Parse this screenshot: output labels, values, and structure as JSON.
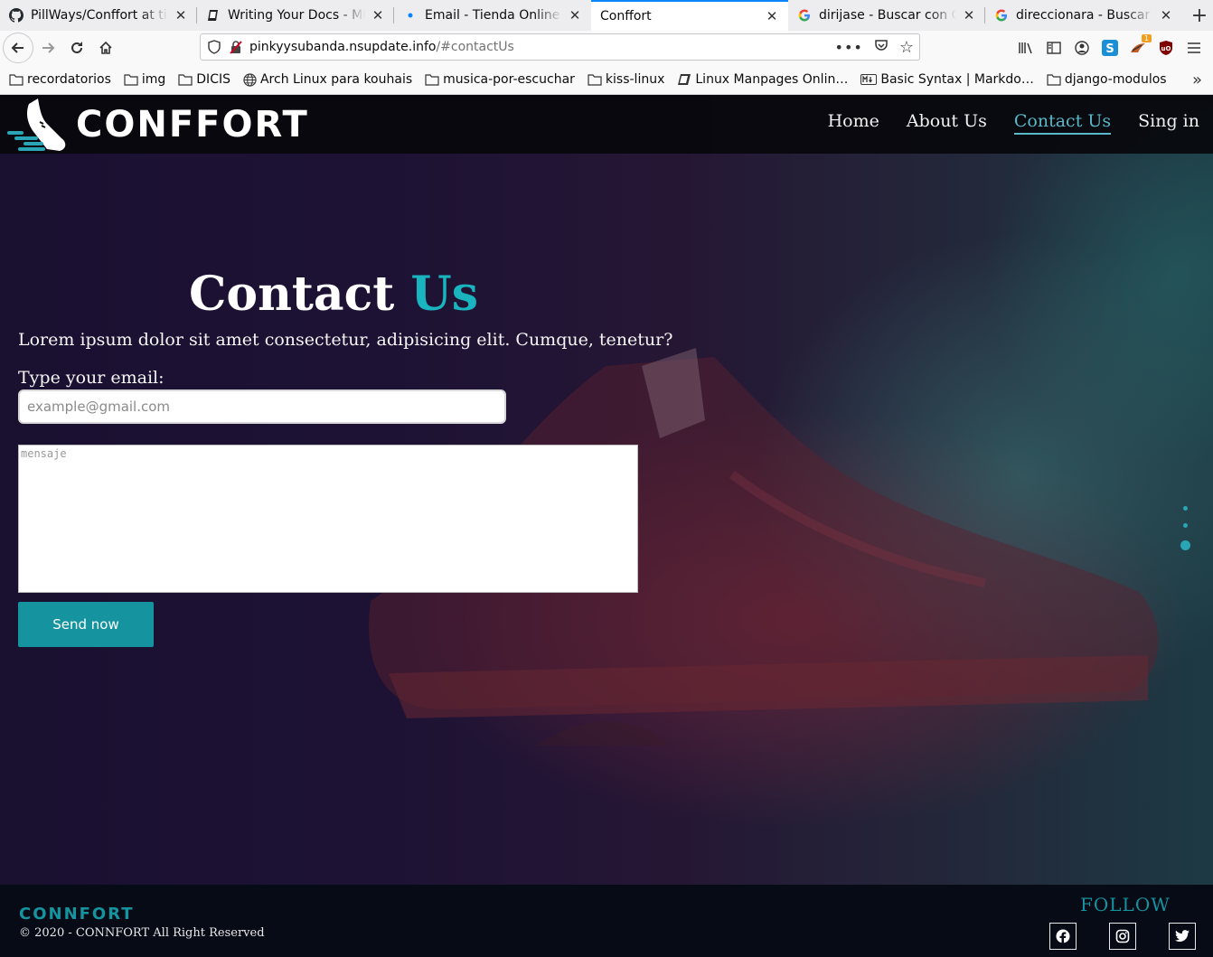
{
  "browser": {
    "tabs": [
      {
        "title": "PillWays/Conffort at tier",
        "icon": "github-icon"
      },
      {
        "title": "Writing Your Docs - MkDocs",
        "icon": "book-icon"
      },
      {
        "title": "Email - Tienda Online Conffort",
        "icon": "dot-icon"
      },
      {
        "title": "Conffort",
        "icon": "none",
        "active": true
      },
      {
        "title": "dirijase - Buscar con Google",
        "icon": "google-icon"
      },
      {
        "title": "direccionara - Buscar con Google",
        "icon": "google-icon"
      }
    ],
    "url_host": "pinkyysubanda.nsupdate.info",
    "url_path": "/#contactUs",
    "bookmarks": [
      {
        "label": "recordatorios",
        "icon": "folder-icon"
      },
      {
        "label": "img",
        "icon": "folder-icon"
      },
      {
        "label": "DICIS",
        "icon": "folder-icon"
      },
      {
        "label": "Arch Linux para kouhais",
        "icon": "globe-icon"
      },
      {
        "label": "musica-por-escuchar",
        "icon": "folder-icon"
      },
      {
        "label": "kiss-linux",
        "icon": "folder-icon"
      },
      {
        "label": "Linux Manpages Onlin…",
        "icon": "book-icon"
      },
      {
        "label": "Basic Syntax | Markdo…",
        "icon": "markdown-icon"
      },
      {
        "label": "django-modulos",
        "icon": "folder-icon"
      }
    ],
    "addon_badge": "1"
  },
  "site": {
    "logo_text": "CONFFORT",
    "nav": [
      "Home",
      "About Us",
      "Contact Us",
      "Sing in"
    ],
    "active_nav": "Contact Us",
    "contact": {
      "title_main": "Contact",
      "title_accent": "Us",
      "description": "Lorem ipsum dolor sit amet consectetur, adipisicing elit. Cumque, tenetur?",
      "email_label": "Type your email:",
      "email_placeholder": "example@gmail.com",
      "message_placeholder": "mensaje",
      "send_label": "Send now"
    },
    "footer": {
      "logo_text": "CONNFORT",
      "copyright": "© 2020 - CONNFORT All Right Reserved",
      "follow_label": "FOLLOW",
      "socials": [
        "facebook-icon",
        "instagram-icon",
        "twitter-icon"
      ]
    },
    "colors": {
      "accent": "#19b4be",
      "button": "#15939f",
      "header_bg": "#08080c",
      "footer_bg": "#060b16"
    }
  }
}
